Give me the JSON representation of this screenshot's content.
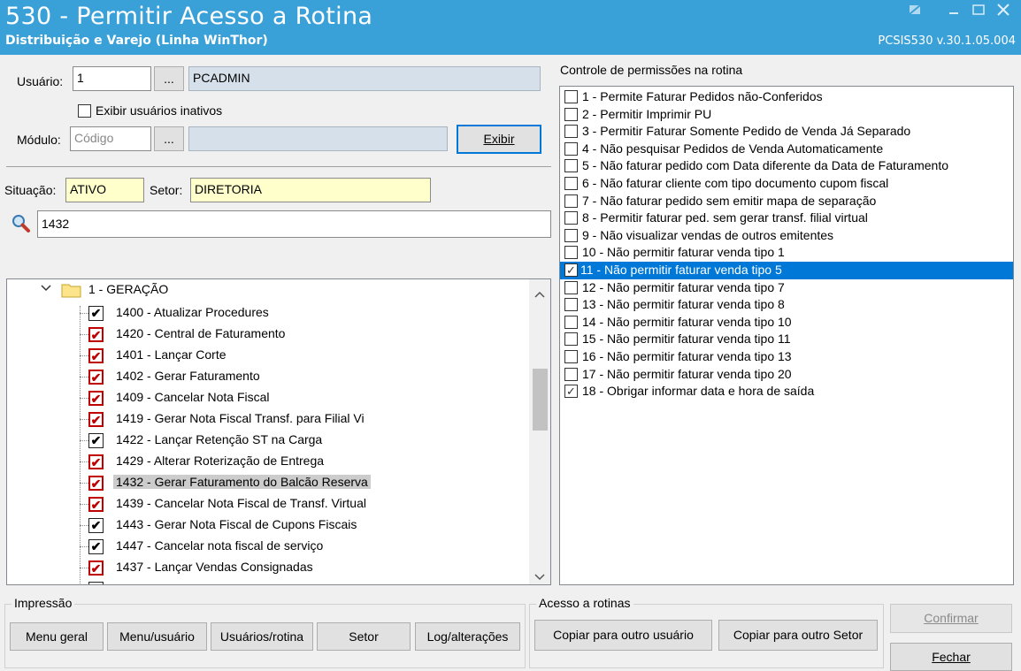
{
  "window": {
    "title": "530 - Permitir Acesso a Rotina",
    "subtitle": "Distribuição e Varejo (Linha WinThor)",
    "version": "PCSIS530  v.30.1.05.004"
  },
  "colors": {
    "titlebar": "#3aa0d8",
    "selection": "#0078d7",
    "yellow_field": "#ffffcc",
    "check_red": "#c00000"
  },
  "usuario": {
    "label": "Usuário:",
    "code": "1",
    "name": "PCADMIN",
    "browse": "..."
  },
  "inativos": {
    "label": "Exibir usuários inativos",
    "checked": false
  },
  "modulo": {
    "label": "Módulo:",
    "placeholder": "Código",
    "browse": "...",
    "exibir": "Exibir"
  },
  "situacao": {
    "label": "Situação:",
    "value": "ATIVO"
  },
  "setor": {
    "label": "Setor:",
    "value": "DIRETORIA"
  },
  "search": {
    "icon": "search-icon",
    "value": "1432"
  },
  "tree": {
    "folder": "1 - GERAÇÃO",
    "items": [
      {
        "label": "1400 - Atualizar Procedures",
        "checked": true,
        "red": false
      },
      {
        "label": "1420 - Central de Faturamento",
        "checked": true,
        "red": true
      },
      {
        "label": "1401 - Lançar Corte",
        "checked": true,
        "red": true
      },
      {
        "label": "1402 - Gerar Faturamento",
        "checked": true,
        "red": true
      },
      {
        "label": "1409 - Cancelar Nota Fiscal",
        "checked": true,
        "red": true
      },
      {
        "label": "1419 - Gerar Nota Fiscal Transf. para Filial Vi",
        "checked": true,
        "red": true
      },
      {
        "label": "1422 - Lançar Retenção ST na Carga",
        "checked": true,
        "red": false
      },
      {
        "label": "1429 - Alterar Roterização de Entrega",
        "checked": true,
        "red": true
      },
      {
        "label": "1432 - Gerar Faturamento do Balcão Reserva",
        "checked": true,
        "red": true,
        "selected": true
      },
      {
        "label": "1439 - Cancelar Nota Fiscal de Transf. Virtual",
        "checked": true,
        "red": true
      },
      {
        "label": "1443 - Gerar Nota Fiscal de Cupons Fiscais",
        "checked": true,
        "red": false
      },
      {
        "label": "1447 - Cancelar nota fiscal de serviço",
        "checked": true,
        "red": false
      },
      {
        "label": "1437 - Lançar Vendas Consignadas",
        "checked": true,
        "red": true
      }
    ]
  },
  "permissoes": {
    "label": "Controle de permissões na rotina",
    "items": [
      {
        "label": "1 - Permite Faturar Pedidos não-Conferidos",
        "checked": false
      },
      {
        "label": "2 - Permitir Imprimir PU",
        "checked": false
      },
      {
        "label": "3 - Permitir Faturar Somente Pedido de Venda Já Separado",
        "checked": false
      },
      {
        "label": "4 - Não pesquisar Pedidos de Venda Automaticamente",
        "checked": false
      },
      {
        "label": "5 - Não faturar pedido com Data diferente da Data de Faturamento",
        "checked": false
      },
      {
        "label": "6 - Não faturar cliente com tipo documento cupom fiscal",
        "checked": false
      },
      {
        "label": "7 - Não faturar pedido sem emitir mapa de separação",
        "checked": false
      },
      {
        "label": "8 - Permitir faturar ped. sem gerar transf. filial virtual",
        "checked": false
      },
      {
        "label": "9 - Não visualizar vendas de outros emitentes",
        "checked": false
      },
      {
        "label": "10 - Não permitir faturar venda tipo 1",
        "checked": false
      },
      {
        "label": "11 - Não permitir faturar venda tipo 5",
        "checked": true,
        "selected": true
      },
      {
        "label": "12 - Não permitir faturar venda tipo 7",
        "checked": false
      },
      {
        "label": "13 - Não permitir faturar venda tipo 8",
        "checked": false
      },
      {
        "label": "14 - Não permitir faturar venda tipo 10",
        "checked": false
      },
      {
        "label": "15 - Não permitir faturar venda tipo 11",
        "checked": false
      },
      {
        "label": "16 - Não permitir faturar venda tipo 13",
        "checked": false
      },
      {
        "label": "17 - Não permitir faturar venda tipo 20",
        "checked": false
      },
      {
        "label": "18 - Obrigar informar data e hora de saída",
        "checked": true
      }
    ]
  },
  "impressao": {
    "label": "Impressão",
    "buttons": [
      "Menu geral",
      "Menu/usuário",
      "Usuários/rotina",
      "Setor",
      "Log/alterações"
    ]
  },
  "acesso": {
    "label": "Acesso a rotinas",
    "buttons": [
      "Copiar para outro usuário",
      "Copiar para outro Setor"
    ]
  },
  "confirmar": "Confirmar",
  "fechar": "Fechar"
}
